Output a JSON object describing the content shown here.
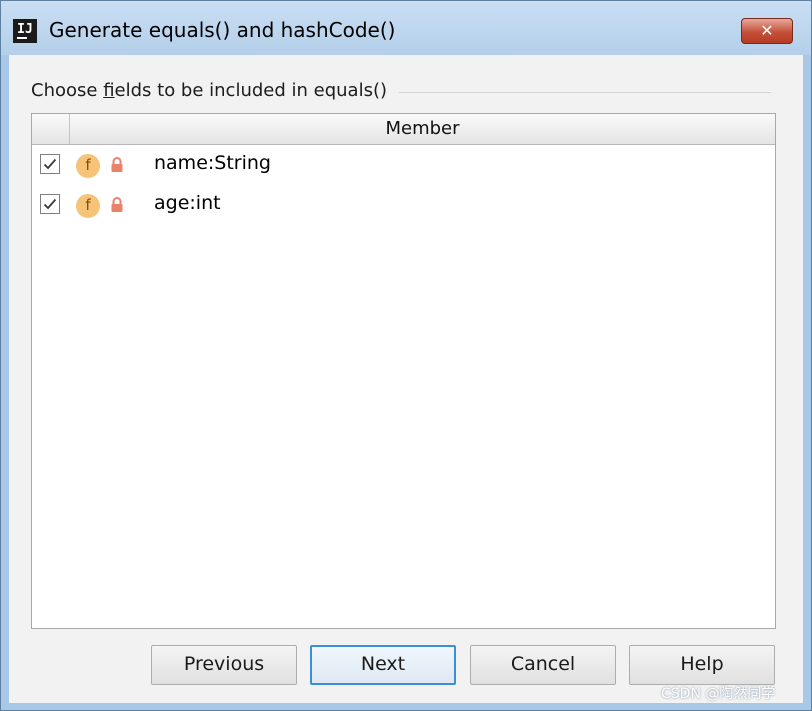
{
  "window": {
    "title": "Generate equals() and hashCode()",
    "logo_text": "IJ",
    "close_glyph": "✕"
  },
  "group": {
    "label_before": "Choose ",
    "label_mnemonic": "f",
    "label_after": "ields to be included in equals()"
  },
  "table": {
    "header_member": "Member",
    "rows": [
      {
        "label": "name:String",
        "checked": true,
        "icon": "field-icon",
        "icon_letter": "f",
        "access_icon": "lock-icon"
      },
      {
        "label": "age:int",
        "checked": true,
        "icon": "field-icon",
        "icon_letter": "f",
        "access_icon": "lock-icon"
      }
    ]
  },
  "buttons": {
    "previous": "Previous",
    "next": "Next",
    "cancel": "Cancel",
    "help": "Help"
  },
  "watermark": "CSDN @陶然同学",
  "colors": {
    "title_bar": "#b4cfea",
    "close_button": "#c4513a",
    "field_icon": "#f5c479",
    "lock_icon": "#e8836a",
    "default_button_border": "#3a8fd6"
  }
}
